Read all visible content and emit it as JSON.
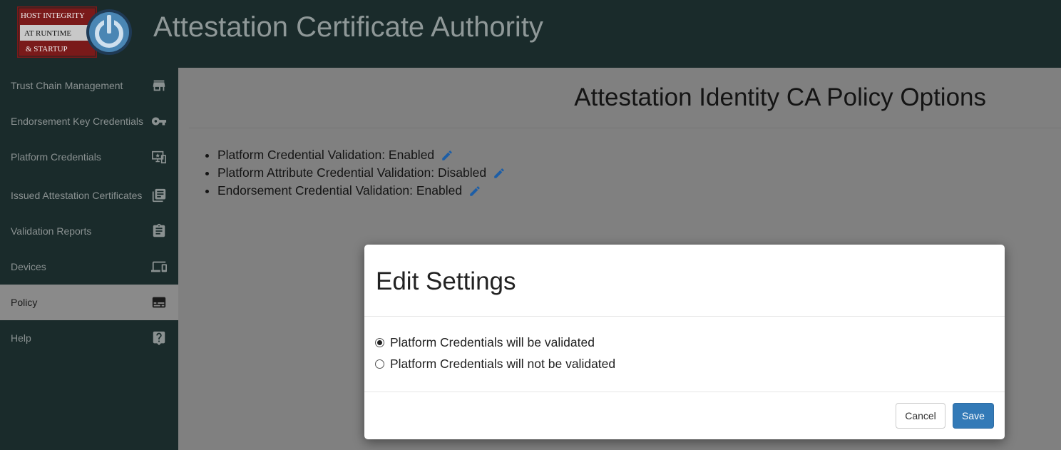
{
  "header": {
    "logo_lines": [
      "HOST INTEGRITY",
      "AT RUNTIME",
      "& STARTUP"
    ],
    "title": "Attestation Certificate Authority"
  },
  "sidebar": {
    "items": [
      {
        "label": "Trust Chain Management",
        "icon": "store-icon",
        "active": false
      },
      {
        "label": "Endorsement Key Credentials",
        "icon": "key-icon",
        "active": false
      },
      {
        "label": "Platform Credentials",
        "icon": "platform-credentials-icon",
        "active": false
      },
      {
        "label": "Issued Attestation Certificates",
        "icon": "library-books-icon",
        "active": false
      },
      {
        "label": "Validation Reports",
        "icon": "clipboard-icon",
        "active": false
      },
      {
        "label": "Devices",
        "icon": "devices-icon",
        "active": false
      },
      {
        "label": "Policy",
        "icon": "subtitles-icon",
        "active": true
      },
      {
        "label": "Help",
        "icon": "help-icon",
        "active": false
      }
    ]
  },
  "main": {
    "title": "Attestation Identity CA Policy Options",
    "policies": [
      {
        "text": "Platform Credential Validation: Enabled"
      },
      {
        "text": "Platform Attribute Credential Validation: Disabled"
      },
      {
        "text": "Endorsement Credential Validation: Enabled"
      }
    ]
  },
  "modal": {
    "title": "Edit Settings",
    "options": [
      {
        "label": "Platform Credentials will be validated",
        "checked": true
      },
      {
        "label": "Platform Credentials will not be validated",
        "checked": false
      }
    ],
    "cancel_label": "Cancel",
    "save_label": "Save"
  },
  "colors": {
    "header_bg": "#1a2b2b",
    "overlay_bg": "#808080",
    "save_button": "#337ab7",
    "edit_icon": "#1d5ea6"
  }
}
